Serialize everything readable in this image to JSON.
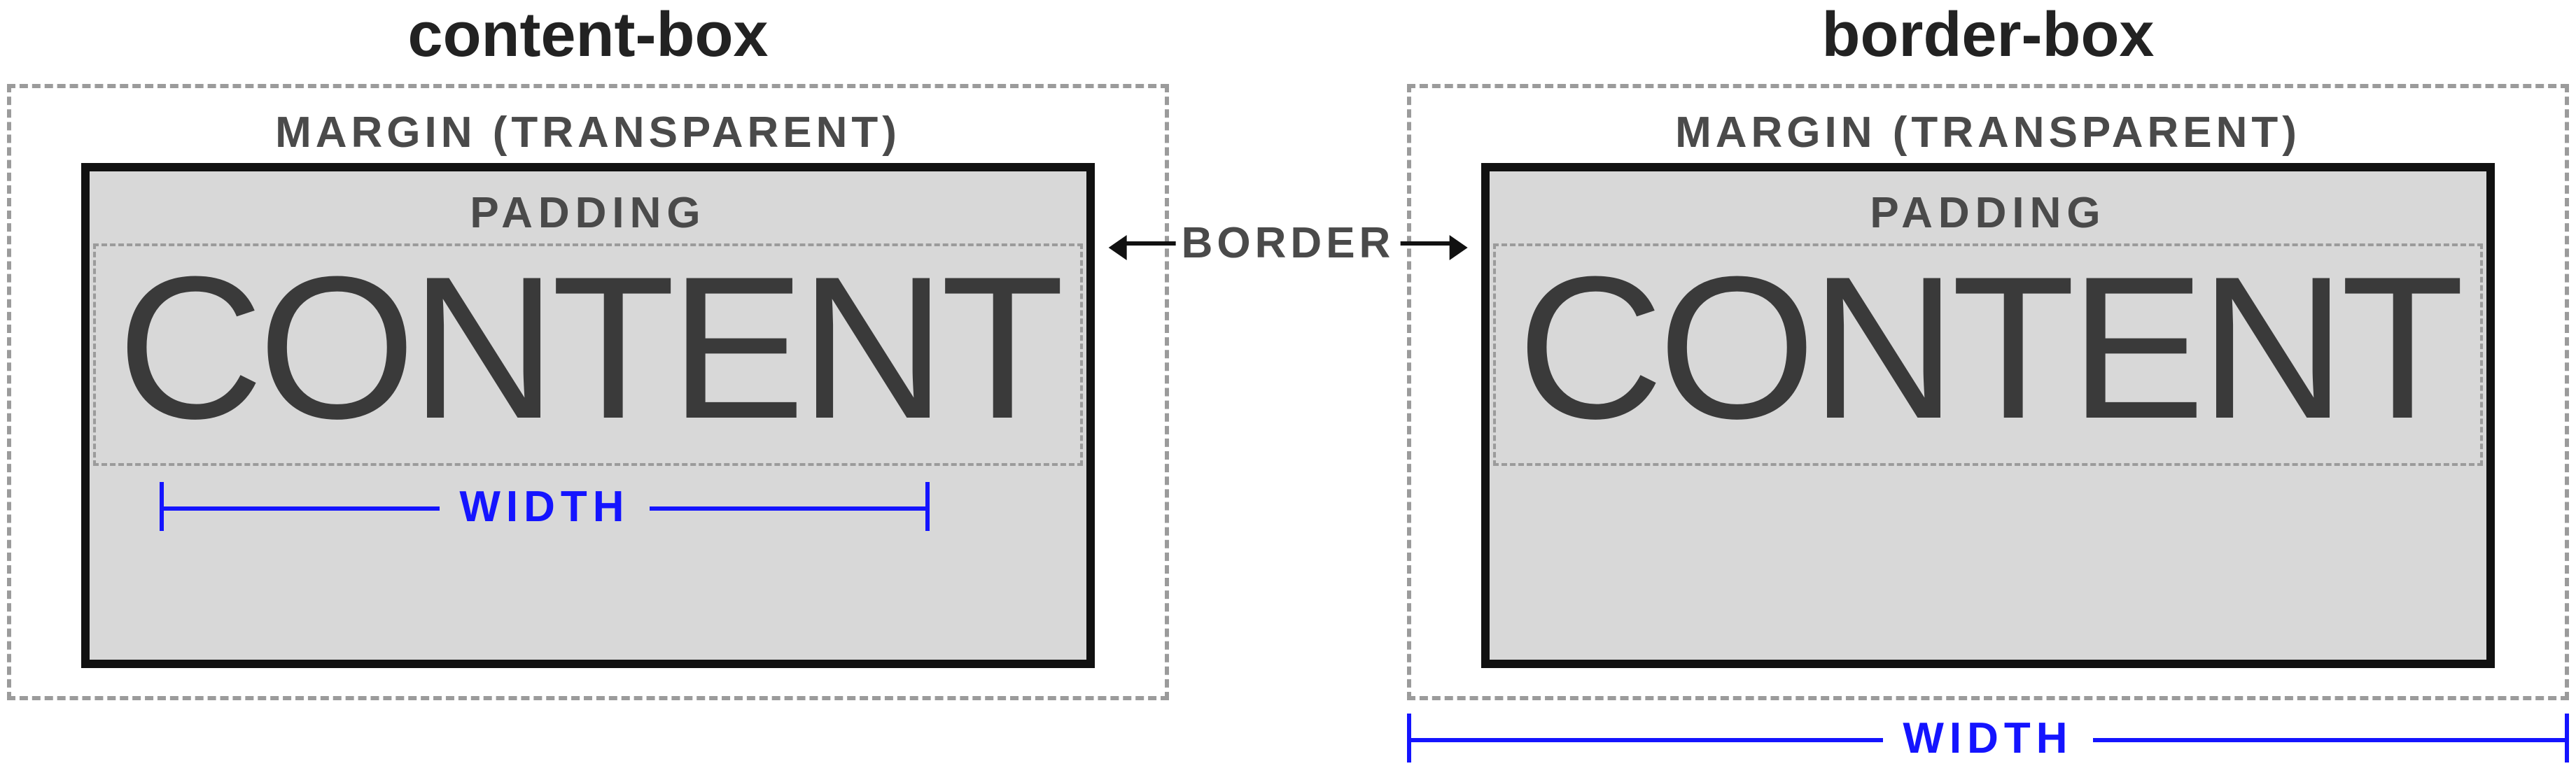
{
  "panels": {
    "left": {
      "title": "content-box",
      "margin_label": "MARGIN (TRANSPARENT)",
      "padding_label": "PADDING",
      "content_label": "CONTENT",
      "width_label": "WIDTH",
      "width_scope": "content"
    },
    "right": {
      "title": "border-box",
      "margin_label": "MARGIN (TRANSPARENT)",
      "padding_label": "PADDING",
      "content_label": "CONTENT",
      "width_label": "WIDTH",
      "width_scope": "border"
    }
  },
  "center": {
    "border_label": "BORDER"
  },
  "colors": {
    "width_ruler": "#1414ff",
    "border": "#111111",
    "dashed": "#9b9b9b",
    "padding_fill": "#d8d8d8",
    "text_label": "#4a4a4a"
  }
}
